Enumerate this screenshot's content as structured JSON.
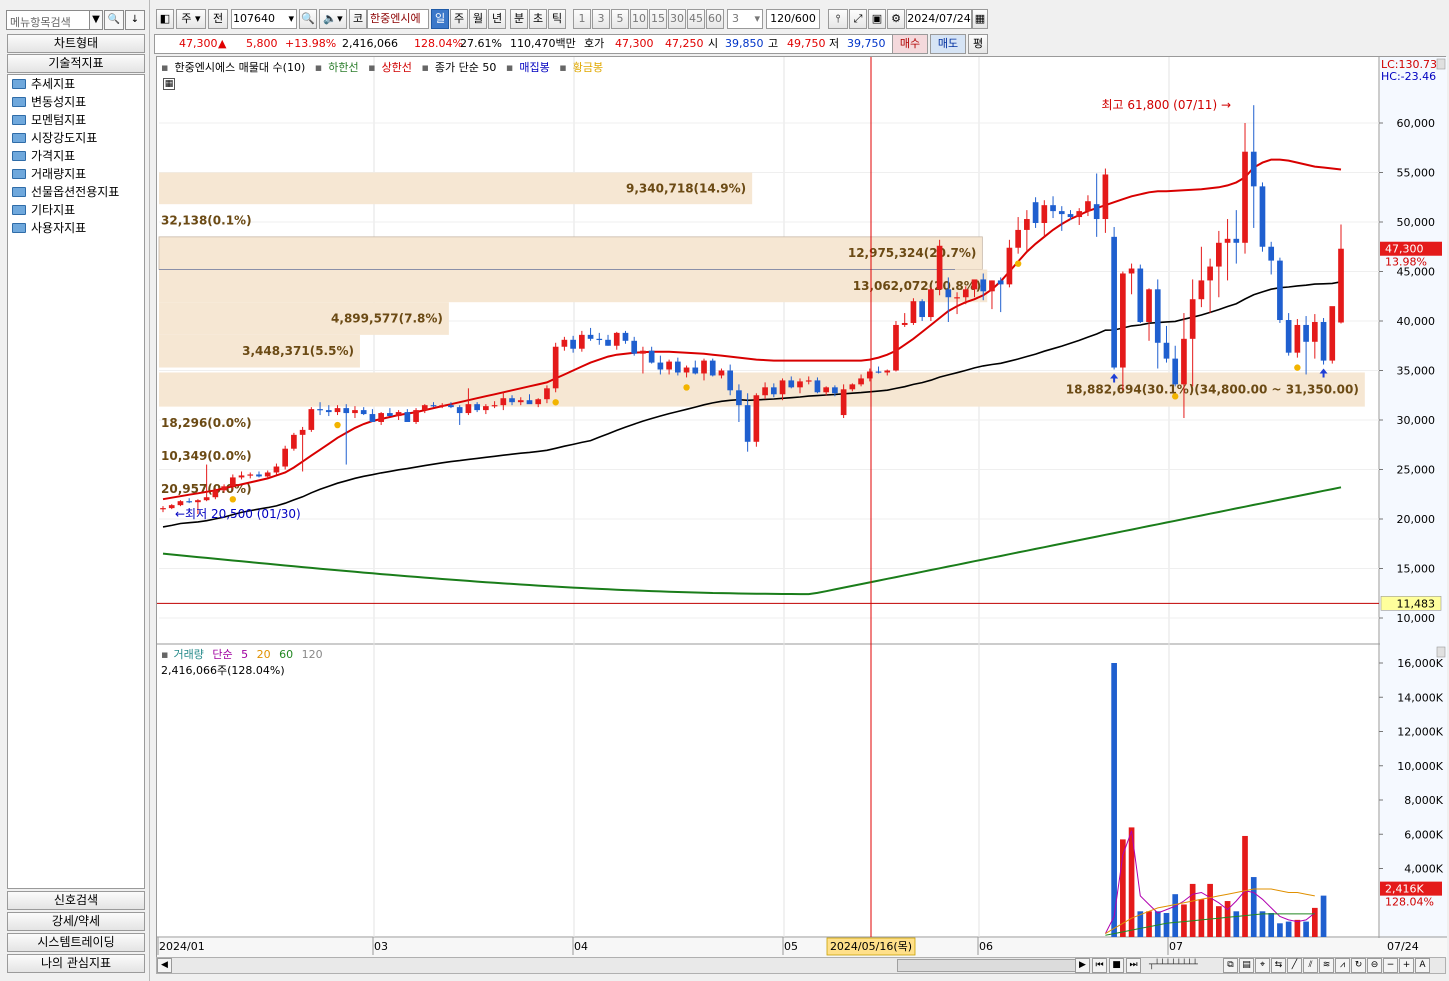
{
  "left_panel": {
    "search_placeholder": "메뉴항목검색",
    "chart_type_label": "차트형태",
    "tech_indicator_label": "기술적지표",
    "tree_items": [
      "추세지표",
      "변동성지표",
      "모멘텀지표",
      "시장강도지표",
      "가격지표",
      "거래량지표",
      "선물옵션전용지표",
      "기타지표",
      "사용자지표"
    ],
    "bottom_buttons": [
      "신호검색",
      "강세/약세",
      "시스템트레이딩",
      "나의 관심지표"
    ]
  },
  "toolbar": {
    "mode_label": "주",
    "prev_label": "전",
    "code": "107640",
    "market_label": "코",
    "stock_name": "한중엔시에",
    "periods": [
      "일",
      "주",
      "월",
      "년",
      "분",
      "초",
      "틱"
    ],
    "active_period": "일",
    "intervals": [
      "1",
      "3",
      "5",
      "10",
      "15",
      "30",
      "45",
      "60"
    ],
    "interval_value": "3",
    "count": "120/600",
    "date": "2024/07/24"
  },
  "quote": {
    "price": "47,300",
    "change": "5,800",
    "change_pct": "+13.98%",
    "volume": "2,416,066",
    "volume_ratio": "128.04%",
    "turnover": "27.61%",
    "amount": "110,470백만",
    "ask_label": "호가",
    "ask1": "47,300",
    "ask2": "47,250",
    "open_label": "시",
    "open": "39,850",
    "high_label": "고",
    "high": "49,750",
    "low_label": "저",
    "low": "39,750",
    "buy_label": "매수",
    "sell_label": "매도",
    "eval_label": "평"
  },
  "legend": {
    "main": "한중엔시에스 매물대 수(10)",
    "lower": "하한선",
    "upper": "상한선",
    "ma": "종가 단순 50",
    "dense": "매집봉",
    "gold": "황금봉"
  },
  "vol_legend": {
    "title": "거래량",
    "simple": "단순",
    "p5": "5",
    "p20": "20",
    "p60": "60",
    "p120": "120",
    "value": "2,416,066주(128.04%)"
  },
  "annotations": {
    "high_label": "최고 61,800 (07/11)",
    "low_label": "최저 20,500 (01/30)",
    "lc": "LC:130.73",
    "hc": "HC:-23.46",
    "current_price_tag": "47,300",
    "current_pct_tag": "13.98%",
    "hline_tag": "11,483",
    "vol_tag": "2,416K",
    "vol_pct_tag": "128.04%",
    "cursor_date": "2024/05/16(목)",
    "end_date": "07/24"
  },
  "chart_data": {
    "type": "candlestick",
    "price_axis": {
      "ylim": [
        10000,
        65000
      ],
      "ticks": [
        "60,000",
        "55,000",
        "50,000",
        "45,000",
        "40,000",
        "35,000",
        "30,000",
        "25,000",
        "20,000",
        "15,000",
        "10,000"
      ]
    },
    "volume_axis": {
      "ticks": [
        "16,000K",
        "14,000K",
        "12,000K",
        "10,000K",
        "8,000K",
        "6,000K",
        "4,000K"
      ]
    },
    "x_ticks": [
      "2024/01",
      "03",
      "04",
      "05",
      "06",
      "07"
    ],
    "volume_profile": [
      {
        "label": "9,340,718(14.9%)",
        "range": [
          51800,
          55000
        ],
        "width_frac": 0.487
      },
      {
        "label": "32,138(0.1%)",
        "range": [
          48500,
          51800
        ],
        "width_frac": 0.0
      },
      {
        "label": "12,975,324(20.7%)",
        "range": [
          45200,
          48500
        ],
        "width_frac": 0.676
      },
      {
        "label": "13,062,072(20.8%)",
        "range": [
          41900,
          45200
        ],
        "width_frac": 0.68
      },
      {
        "label": "4,899,577(7.8%)",
        "range": [
          38600,
          41900
        ],
        "width_frac": 0.238
      },
      {
        "label": "3,448,371(5.5%)",
        "range": [
          35300,
          38600
        ],
        "width_frac": 0.165
      },
      {
        "label": "18,882,694(30.1%)(34,800.00 ~ 31,350.00)",
        "range": [
          31350,
          34800
        ],
        "width_frac": 0.99
      },
      {
        "label": "18,296(0.0%)",
        "range": [
          28000,
          31350
        ],
        "width_frac": 0.0
      },
      {
        "label": "10,349(0.0%)",
        "range": [
          24700,
          28000
        ],
        "width_frac": 0.0
      },
      {
        "label": "20,957(0.0%)",
        "range": [
          21400,
          24700
        ],
        "width_frac": 0.0
      }
    ],
    "candles": [
      [
        21000,
        21300,
        20700,
        21100
      ],
      [
        21100,
        21500,
        21000,
        21400
      ],
      [
        21400,
        21900,
        21300,
        21800
      ],
      [
        21800,
        22100,
        21600,
        21700
      ],
      [
        21700,
        22000,
        20500,
        21900
      ],
      [
        21900,
        25500,
        21800,
        22200
      ],
      [
        22200,
        23100,
        22000,
        22900
      ],
      [
        22900,
        23500,
        22700,
        23300
      ],
      [
        23300,
        24500,
        23000,
        24200
      ],
      [
        24200,
        24800,
        24000,
        24400
      ],
      [
        24400,
        24700,
        24100,
        24500
      ],
      [
        24500,
        24800,
        24200,
        24300
      ],
      [
        24300,
        24900,
        24100,
        24700
      ],
      [
        24700,
        25600,
        24500,
        25300
      ],
      [
        25300,
        27400,
        25000,
        27100
      ],
      [
        27100,
        28700,
        26900,
        28500
      ],
      [
        28500,
        29300,
        24800,
        29000
      ],
      [
        29000,
        31300,
        28800,
        31100
      ],
      [
        31100,
        31800,
        30500,
        31000
      ],
      [
        31000,
        31500,
        30400,
        30800
      ],
      [
        30800,
        31500,
        30500,
        31200
      ],
      [
        31200,
        31600,
        25500,
        30700
      ],
      [
        30700,
        31400,
        30200,
        31000
      ],
      [
        31000,
        31300,
        30500,
        30600
      ],
      [
        30600,
        31100,
        30300,
        29800
      ],
      [
        29800,
        30800,
        29500,
        30700
      ],
      [
        30700,
        31200,
        30400,
        30400
      ],
      [
        30400,
        31000,
        30000,
        30800
      ],
      [
        30800,
        31100,
        30200,
        29800
      ],
      [
        29800,
        31200,
        29600,
        31000
      ],
      [
        31000,
        31600,
        30700,
        31500
      ],
      [
        31500,
        31800,
        31300,
        31400
      ],
      [
        31400,
        31700,
        31200,
        31500
      ],
      [
        31500,
        31800,
        31200,
        31300
      ],
      [
        31300,
        31500,
        29500,
        30700
      ],
      [
        30700,
        33200,
        30500,
        31600
      ],
      [
        31600,
        31800,
        30800,
        31000
      ],
      [
        31000,
        31600,
        30600,
        31400
      ],
      [
        31400,
        31900,
        31200,
        31500
      ],
      [
        31500,
        32800,
        31000,
        32200
      ],
      [
        32200,
        32500,
        31500,
        31800
      ],
      [
        31800,
        32300,
        31500,
        32000
      ],
      [
        32000,
        32600,
        31700,
        31600
      ],
      [
        31600,
        32200,
        31300,
        32100
      ],
      [
        32100,
        33500,
        31700,
        33200
      ],
      [
        33200,
        37800,
        32800,
        37400
      ],
      [
        37400,
        38400,
        37000,
        38100
      ],
      [
        38100,
        38500,
        36800,
        37200
      ],
      [
        37200,
        39000,
        36900,
        38600
      ],
      [
        38600,
        39300,
        38000,
        38200
      ],
      [
        38200,
        38800,
        37600,
        38100
      ],
      [
        38100,
        38600,
        37500,
        37500
      ],
      [
        37500,
        38900,
        37100,
        38800
      ],
      [
        38800,
        39000,
        37700,
        38000
      ],
      [
        38000,
        38400,
        36500,
        36700
      ],
      [
        36700,
        37400,
        34700,
        37000
      ],
      [
        37000,
        37400,
        35700,
        35800
      ],
      [
        35800,
        36500,
        34600,
        35100
      ],
      [
        35100,
        36100,
        34600,
        35900
      ],
      [
        35900,
        36300,
        34500,
        34800
      ],
      [
        34800,
        35500,
        34300,
        35300
      ],
      [
        35300,
        36000,
        34600,
        34700
      ],
      [
        34700,
        36200,
        34000,
        36000
      ],
      [
        36000,
        36200,
        34400,
        34500
      ],
      [
        34500,
        35200,
        34200,
        35000
      ],
      [
        35000,
        35600,
        32500,
        33000
      ],
      [
        33000,
        33600,
        29800,
        31500
      ],
      [
        31500,
        32700,
        26800,
        27800
      ],
      [
        27800,
        32700,
        27300,
        32500
      ],
      [
        32500,
        33800,
        32100,
        33300
      ],
      [
        33300,
        33700,
        32300,
        32600
      ],
      [
        32600,
        34200,
        32000,
        34000
      ],
      [
        34000,
        34400,
        33200,
        33300
      ],
      [
        33300,
        34200,
        32700,
        33900
      ],
      [
        33900,
        34400,
        33600,
        34000
      ],
      [
        34000,
        34300,
        32700,
        32800
      ],
      [
        32800,
        33400,
        32500,
        33300
      ],
      [
        33300,
        33500,
        32400,
        32700
      ],
      [
        30500,
        33600,
        30200,
        33100
      ],
      [
        33100,
        33700,
        32900,
        33600
      ],
      [
        33600,
        34600,
        33400,
        34200
      ],
      [
        34200,
        35200,
        33900,
        34900
      ],
      [
        34900,
        35400,
        34700,
        34800
      ],
      [
        34800,
        35100,
        34500,
        35000
      ],
      [
        35000,
        40000,
        34900,
        39600
      ],
      [
        39600,
        40800,
        39400,
        39800
      ],
      [
        39800,
        42300,
        39600,
        42000
      ],
      [
        42000,
        42200,
        40000,
        40400
      ],
      [
        40400,
        43400,
        40000,
        43200
      ],
      [
        43200,
        48200,
        42600,
        47600
      ],
      [
        43200,
        44400,
        39900,
        42400
      ],
      [
        42400,
        42900,
        40700,
        42400
      ],
      [
        42400,
        43500,
        41700,
        43200
      ],
      [
        43200,
        44100,
        42400,
        44200
      ],
      [
        44200,
        44800,
        42100,
        43000
      ],
      [
        43000,
        44100,
        41200,
        44100
      ],
      [
        44100,
        44400,
        40900,
        43700
      ],
      [
        43700,
        48200,
        43400,
        47400
      ],
      [
        47400,
        50500,
        46800,
        49200
      ],
      [
        49200,
        51200,
        47000,
        50300
      ],
      [
        52000,
        52500,
        49400,
        49900
      ],
      [
        49900,
        52200,
        48500,
        51700
      ],
      [
        51700,
        52600,
        50400,
        51100
      ],
      [
        51100,
        51600,
        49100,
        50800
      ],
      [
        50800,
        51200,
        50200,
        50500
      ],
      [
        50500,
        51400,
        49700,
        51100
      ],
      [
        51100,
        52700,
        50600,
        52100
      ],
      [
        51800,
        54900,
        48500,
        50300
      ],
      [
        50300,
        55400,
        48900,
        54800
      ],
      [
        48500,
        49500,
        35100,
        35300
      ],
      [
        35300,
        45000,
        33000,
        44800
      ],
      [
        44800,
        45800,
        42700,
        45300
      ],
      [
        45300,
        45700,
        39800,
        39900
      ],
      [
        39900,
        43300,
        38000,
        43200
      ],
      [
        43200,
        44200,
        35200,
        37800
      ],
      [
        37800,
        39500,
        35800,
        36200
      ],
      [
        36200,
        37500,
        33400,
        33600
      ],
      [
        33600,
        40800,
        30200,
        38200
      ],
      [
        38200,
        44200,
        33400,
        42200
      ],
      [
        42200,
        47500,
        41400,
        44100
      ],
      [
        44100,
        46300,
        40800,
        45500
      ],
      [
        45500,
        49100,
        42400,
        47900
      ],
      [
        47900,
        50300,
        44100,
        48300
      ],
      [
        48300,
        51200,
        45800,
        47900
      ],
      [
        47900,
        60000,
        46800,
        57100
      ],
      [
        57100,
        61800,
        49400,
        53600
      ],
      [
        53600,
        54000,
        47000,
        47500
      ],
      [
        47500,
        48000,
        44700,
        46100
      ],
      [
        46100,
        46400,
        39800,
        40100
      ],
      [
        40100,
        40800,
        36500,
        36800
      ],
      [
        36800,
        40200,
        36300,
        39600
      ],
      [
        39600,
        40500,
        34600,
        37900
      ],
      [
        37900,
        40700,
        36200,
        39900
      ],
      [
        39900,
        40300,
        35600,
        36000
      ],
      [
        36000,
        40800,
        35700,
        41500
      ],
      [
        39850,
        49750,
        39750,
        47300
      ]
    ],
    "upper_band": [
      22000,
      22150,
      22300,
      22450,
      22600,
      22750,
      22900,
      23100,
      23300,
      23500,
      23700,
      23900,
      24100,
      24400,
      24700,
      25200,
      25800,
      26400,
      27000,
      27600,
      28200,
      28700,
      29200,
      29600,
      29900,
      30100,
      30300,
      30500,
      30650,
      30800,
      31000,
      31200,
      31400,
      31600,
      31800,
      32000,
      32200,
      32400,
      32600,
      32800,
      33000,
      33200,
      33400,
      33600,
      33800,
      34200,
      34600,
      35000,
      35400,
      35800,
      36100,
      36400,
      36600,
      36700,
      36800,
      36850,
      36900,
      36900,
      36900,
      36850,
      36800,
      36750,
      36700,
      36600,
      36500,
      36400,
      36300,
      36200,
      36100,
      36050,
      36000,
      36000,
      36000,
      36000,
      36000,
      36000,
      36000,
      36000,
      36000,
      36000,
      36000,
      36100,
      36300,
      36600,
      37000,
      37600,
      38200,
      38900,
      39600,
      40300,
      41000,
      41500,
      41900,
      42200,
      42600,
      43200,
      44000,
      45000,
      46000,
      47000,
      47800,
      48500,
      49200,
      49800,
      50300,
      50700,
      51100,
      51400,
      51700,
      52000,
      52300,
      52600,
      52800,
      53000,
      53100,
      53100,
      53150,
      53200,
      53250,
      53300,
      53400,
      53500,
      53700,
      54000,
      54500,
      55500,
      56000,
      56300,
      56300,
      56200,
      56000,
      55800,
      55600,
      55500,
      55400,
      55300
    ]
  }
}
